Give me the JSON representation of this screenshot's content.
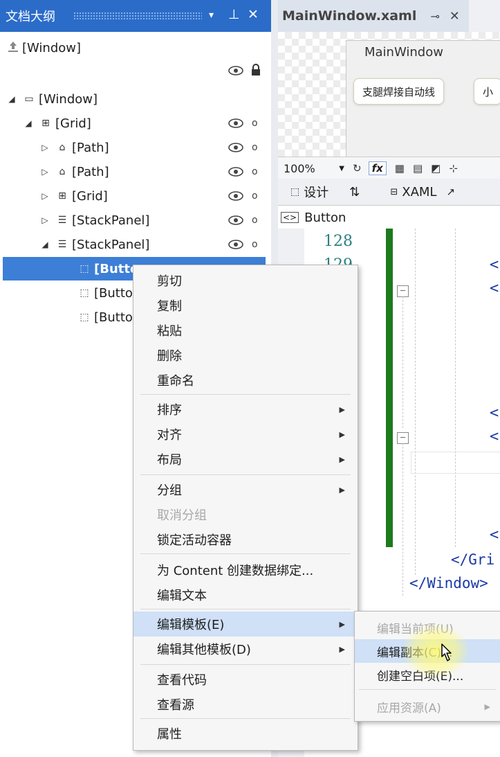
{
  "outline": {
    "title": "文档大纲",
    "header_buttons": [
      "▾",
      "⊥",
      "✕"
    ],
    "root_label": "[Window]",
    "root_icon": "up-arrow-icon",
    "tree": [
      {
        "label": "[Window]",
        "icon": "window-icon",
        "toggle": "◢",
        "level": 0
      },
      {
        "label": "[Grid]",
        "icon": "grid-icon",
        "toggle": "◢",
        "level": 1
      },
      {
        "label": "[Path]",
        "icon": "path-icon",
        "toggle": "▷",
        "level": 2
      },
      {
        "label": "[Path]",
        "icon": "path-icon",
        "toggle": "▷",
        "level": 2
      },
      {
        "label": "[Grid]",
        "icon": "grid-icon",
        "toggle": "▷",
        "level": 2
      },
      {
        "label": "[StackPanel]",
        "icon": "stackpanel-icon",
        "toggle": "▷",
        "level": 2
      },
      {
        "label": "[StackPanel]",
        "icon": "stackpanel-icon",
        "toggle": "◢",
        "level": 2
      },
      {
        "label": "[Butto",
        "icon": "button-icon",
        "toggle": "",
        "level": 3,
        "selected": true
      },
      {
        "label": "[Butto",
        "icon": "button-icon",
        "toggle": "",
        "level": 3
      },
      {
        "label": "[Butto",
        "icon": "button-icon",
        "toggle": "",
        "level": 3
      }
    ]
  },
  "designer": {
    "tab_title": "MainWindow.xaml",
    "tab_pin": "⊸",
    "tab_close": "✕",
    "window_title": "MainWindow",
    "preview_buttons": [
      "支腿焊接自动线",
      "小"
    ],
    "zoom": "100%",
    "fx": "fx",
    "design_tab": "设计",
    "swap_icon": "⇅",
    "xaml_tab": "XAML",
    "breadcrumb": "Button",
    "line_numbers": [
      "128",
      "129"
    ],
    "code_lines": [
      "</Gri",
      "</Window>"
    ]
  },
  "context_menu": {
    "items": [
      {
        "label": "剪切"
      },
      {
        "label": "复制"
      },
      {
        "label": "粘贴"
      },
      {
        "label": "删除"
      },
      {
        "label": "重命名"
      },
      {
        "label": "排序",
        "submenu": true
      },
      {
        "label": "对齐",
        "submenu": true
      },
      {
        "label": "布局",
        "submenu": true
      },
      {
        "label": "分组",
        "submenu": true
      },
      {
        "label": "取消分组",
        "disabled": true
      },
      {
        "label": "锁定活动容器"
      },
      {
        "label": "为 Content 创建数据绑定..."
      },
      {
        "label": "编辑文本"
      },
      {
        "label": "编辑模板(E)",
        "submenu": true,
        "highlighted": true
      },
      {
        "label": "编辑其他模板(D)",
        "submenu": true
      },
      {
        "label": "查看代码"
      },
      {
        "label": "查看源"
      },
      {
        "label": "属性"
      }
    ]
  },
  "submenu": {
    "items": [
      {
        "label": "编辑当前项(U)",
        "disabled": true
      },
      {
        "label": "编辑副本(C)...",
        "highlighted": true
      },
      {
        "label": "创建空白项(E)..."
      },
      {
        "label": "应用资源(A)",
        "disabled": true,
        "submenu": true
      }
    ]
  }
}
